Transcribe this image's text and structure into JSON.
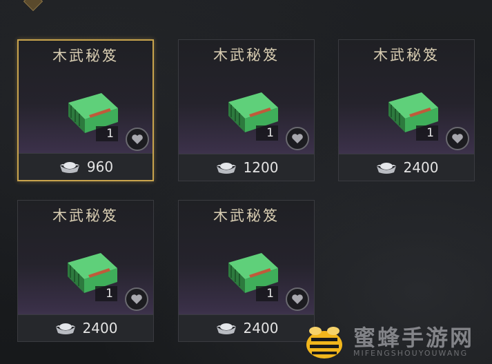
{
  "items": [
    {
      "name": "木武秘笈",
      "quantity": "1",
      "price": "960",
      "selected": true
    },
    {
      "name": "木武秘笈",
      "quantity": "1",
      "price": "1200",
      "selected": false
    },
    {
      "name": "木武秘笈",
      "quantity": "1",
      "price": "2400",
      "selected": false
    },
    {
      "name": "木武秘笈",
      "quantity": "1",
      "price": "2400",
      "selected": false
    },
    {
      "name": "木武秘笈",
      "quantity": "1",
      "price": "2400",
      "selected": false
    }
  ],
  "icons": {
    "item": "green-book-icon",
    "favorite": "heart-icon",
    "currency": "silver-ingot-icon"
  },
  "colors": {
    "selected_border": "#c9a44d",
    "book_green": "#3fae5a"
  },
  "watermark": {
    "title": "蜜蜂手游网",
    "subtitle": "MIFENGSHOUYOUWANG"
  }
}
